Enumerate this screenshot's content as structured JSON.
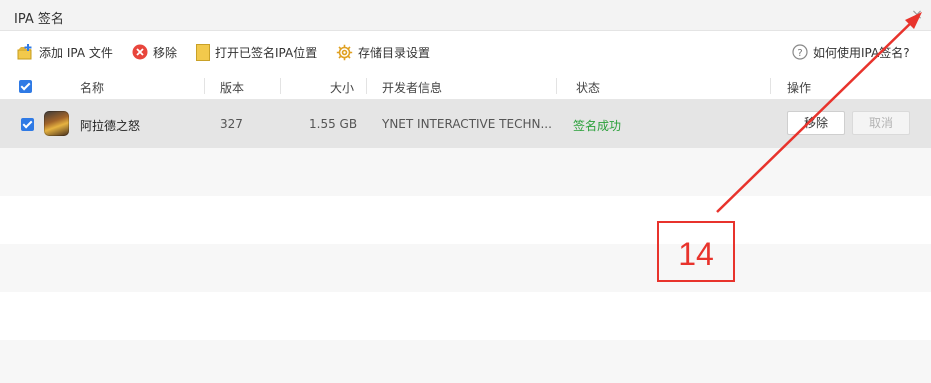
{
  "window": {
    "title": "IPA 签名",
    "close_icon": "close-icon"
  },
  "toolbar": {
    "add_label": "添加 IPA 文件",
    "remove_label": "移除",
    "open_folder_label": "打开已签名IPA位置",
    "storage_settings_label": "存储目录设置",
    "help_label": "如何使用IPA签名?"
  },
  "table": {
    "columns": [
      "名称",
      "版本",
      "大小",
      "开发者信息",
      "状态",
      "操作"
    ],
    "rows": [
      {
        "name": "阿拉德之怒",
        "version": "327",
        "size": "1.55 GB",
        "developer": "YNET INTERACTIVE TECHN...",
        "status": "签名成功",
        "remove_button": "移除",
        "cancel_button": "取消"
      }
    ]
  },
  "annotation": {
    "number": "14"
  },
  "colors": {
    "accent": "#2f7ae5",
    "success": "#2aa03a",
    "annotation": "#e8332c"
  }
}
